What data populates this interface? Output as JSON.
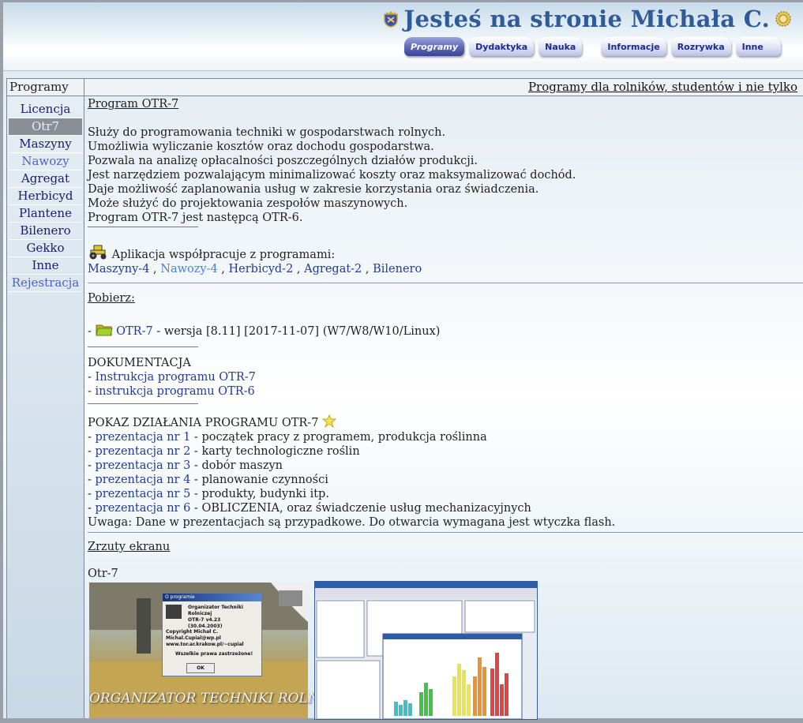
{
  "header": {
    "site_title": "Jesteś na stronie Michała C.",
    "tabs": [
      {
        "label": "Programy",
        "active": true
      },
      {
        "label": "Dydaktyka",
        "active": false
      },
      {
        "label": "Nauka",
        "active": false
      },
      {
        "label": "Informacje",
        "active": false
      },
      {
        "label": "Rozrywka",
        "active": false
      },
      {
        "label": "Inne",
        "active": false
      }
    ]
  },
  "sidebar": {
    "heading": "Programy",
    "items": [
      {
        "label": "Licencja"
      },
      {
        "label": "Otr7",
        "active": true
      },
      {
        "label": "Maszyny"
      },
      {
        "label": "Nawozy"
      },
      {
        "label": "Agregat"
      },
      {
        "label": "Herbicyd"
      },
      {
        "label": "Plantene"
      },
      {
        "label": "Bilenero"
      },
      {
        "label": "Gekko"
      },
      {
        "label": "Inne"
      },
      {
        "label": "Rejestracja"
      }
    ]
  },
  "main": {
    "heading": "Programy dla rolników, studentów i nie tylko",
    "program_title": "Program OTR-7",
    "description": [
      "Służy do programowania techniki w gospodarstwach rolnych.",
      "Umożliwia wyliczanie kosztów oraz dochodu gospodarstwa.",
      "Pozwala na analizę opłacalności poszczególnych działów produkcji.",
      "Jest narzędziem pozwalającym minimalizować koszty oraz maksymalizować dochód.",
      "Daje możliwość zaplanowania usług w zakresie korzystania oraz świadczenia.",
      "Może służyć do projektowania zespołów maszynowych.",
      "Program OTR-7 jest następcą OTR-6."
    ],
    "cooperation_text": "Aplikacja współpracuje z programami:",
    "cooperation_links": [
      "Maszyny-4",
      "Nawozy-4",
      "Herbicyd-2",
      "Agregat-2",
      "Bilenero"
    ],
    "download_heading": "Pobierz:",
    "download_link": "OTR-7",
    "download_version": " - wersja [8.11] [2017-11-07] (W7/W8/W10/Linux)",
    "docs_heading": "DOKUMENTACJA",
    "docs_links": [
      "Instrukcja programu OTR-7",
      "instrukcja programu OTR-6"
    ],
    "demo_heading": "POKAZ DZIAŁANIA PROGRAMU OTR-7",
    "presentations": [
      {
        "link": "prezentacja nr 1",
        "desc": " - początek pracy z programem, produkcja roślinna"
      },
      {
        "link": "prezentacja nr 2",
        "desc": " - karty technologiczne roślin"
      },
      {
        "link": "prezentacja nr 3",
        "desc": " - dobór maszyn"
      },
      {
        "link": "prezentacja nr 4",
        "desc": " - planowanie czynności"
      },
      {
        "link": "prezentacja nr 5",
        "desc": " - produkty, budynki itp."
      },
      {
        "link": "prezentacja nr 6",
        "desc": " - OBLICZENIA, oraz świadczenie usług mechanizacyjnych"
      }
    ],
    "demo_note": "Uwaga: Dane w prezentacjach są przypadkowe. Do otwarcia wymagana jest wtyczka flash.",
    "screenshots_heading": "Zrzuty ekranu",
    "screenshots_caption": "Otr-7",
    "splash": {
      "dialog_title": "O programie",
      "line1": "Organizator Techniki Rolniczej",
      "line2": "OTR-7 v4.23",
      "line3": "(30.04.2003)",
      "copyright": "Copyright Michał C.",
      "email": "Michal.Cupial@wp.pl",
      "www": "www.tor.ar.krakow.pl/~cupial",
      "rights": "Wszelkie prawa zastrzeżone!",
      "ok_label": "OK",
      "banner": "ORGANIZATOR TECHNIKI ROLNICZEJ"
    }
  }
}
